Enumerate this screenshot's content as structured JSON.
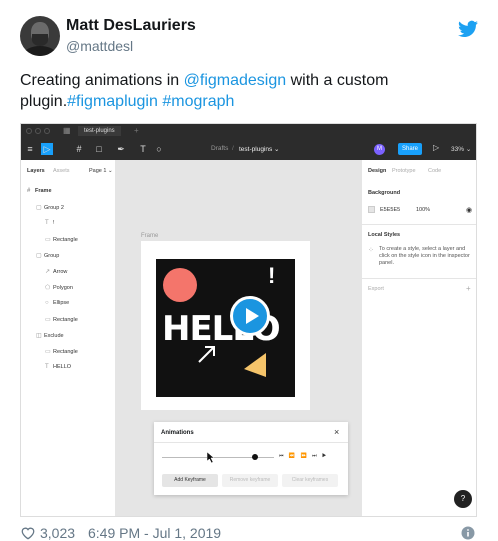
{
  "tweet": {
    "name": "Matt DesLauriers",
    "handle": "@mattdesl",
    "text_1": "Creating animations in ",
    "mention": "@figmadesign",
    "text_2": " with a custom plugin.",
    "hashtag_1": "#figmaplugin",
    "hashtag_2": "#mograph",
    "likes": "3,023",
    "timestamp": "6:49 PM - Jul 1, 2019"
  },
  "figma": {
    "tab_title": "test-plugins",
    "breadcrumb_drafts": "Drafts",
    "breadcrumb_sep": "/",
    "breadcrumb_file": "test-plugins ⌄",
    "avatar_letter": "M",
    "share_label": "Share",
    "zoom": "33% ⌄",
    "left_tabs": {
      "layers": "Layers",
      "assets": "Assets",
      "page": "Page 1 ⌄"
    },
    "layers": [
      {
        "label": "Frame",
        "depth": 0
      },
      {
        "label": "Group 2",
        "depth": 1
      },
      {
        "label": "!",
        "depth": 2
      },
      {
        "label": "Rectangle",
        "depth": 2
      },
      {
        "label": "Group",
        "depth": 1
      },
      {
        "label": "Arrow",
        "depth": 2
      },
      {
        "label": "Polygon",
        "depth": 2
      },
      {
        "label": "Ellipse",
        "depth": 2
      },
      {
        "label": "Rectangle",
        "depth": 2
      },
      {
        "label": "Exclude",
        "depth": 1
      },
      {
        "label": "Rectangle",
        "depth": 2
      },
      {
        "label": "HELLO",
        "depth": 2
      }
    ],
    "right_tabs": {
      "design": "Design",
      "prototype": "Prototype",
      "code": "Code"
    },
    "background_title": "Background",
    "bg_hex": "E5E5E5",
    "bg_opacity": "100%",
    "local_styles_title": "Local Styles",
    "local_styles_hint": "To create a style, select a layer and click on the style icon in the inspector panel.",
    "export_title": "Export",
    "frame_label": "Frame",
    "art_text": "HELLO",
    "art_bang": "!",
    "animations_title": "Animations",
    "add_keyframe": "Add Keyframe",
    "remove_keyframe": "Remove keyframe",
    "clear_keyframes": "Clear keyframes",
    "help": "?"
  },
  "colors": {
    "link": "#1b95e0",
    "figma_blue": "#18a0fb",
    "accent_coral": "#f4756b",
    "accent_yellow": "#f5c46a"
  }
}
